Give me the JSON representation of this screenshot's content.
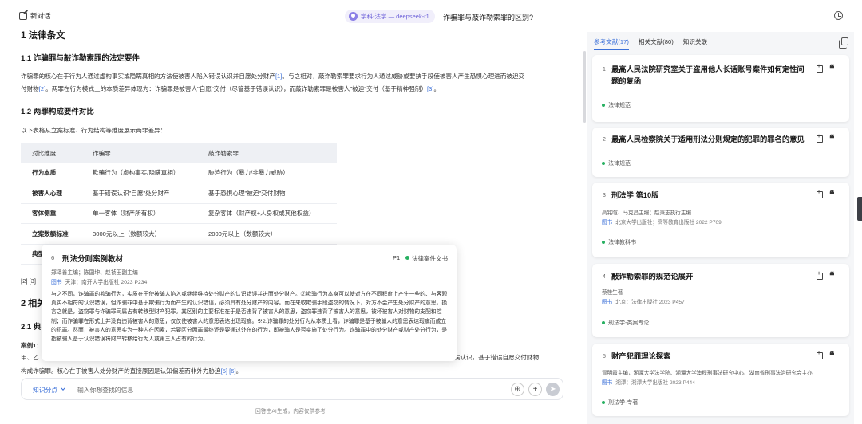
{
  "topbar": {
    "new_chat": "新对话",
    "mode": "学科-法学 — deepseek-r1",
    "chat_title": "诈骗罪与敲诈勒索罪的区别?"
  },
  "article": {
    "h1": "1 法律条文",
    "s1_title": "1.1 诈骗罪与敲诈勒索罪的法定要件",
    "s1_line1": "诈骗罪的核心在于行为人通过虚构事实或隐瞒真相的方法使被害人陷入错误认识并自愿处分财产[1]。与之相对，敲诈勒索罪要求行为人通过威胁或要挟手段使被害人产生恐惧心理进而被迫交",
    "s1_line2": "付财物[2]。两罪在行为模式上的本质差异体现为：诈骗罪是被害人\"自愿\"交付（尽管基于错误认识），而敲诈勒索罪是被害人\"被迫\"交付（基于精神强制）[3]。",
    "s2_title": "1.2 两罪构成要件对比",
    "intro": "以下表格从立案标准、行为结构等维度展示两罪差异：",
    "table": {
      "headers": [
        "对比维度",
        "诈骗罪",
        "敲诈勒索罪"
      ],
      "rows": [
        [
          "行为本质",
          "欺骗行为（虚构事实/隐瞒真相）",
          "胁迫行为（暴力/非暴力威胁）"
        ],
        [
          "被害人心理",
          "基于错误认识\"自愿\"处分财产",
          "基于恐惧心理\"被迫\"交付财物"
        ],
        [
          "客体侧重",
          "单一客体（财产所有权）",
          "复杂客体（财产权+人身权或其他权益）"
        ],
        [
          "立案数额标准",
          "3000元以上（数额较大）",
          "2000元以上（数额较大）"
        ],
        [
          "典型",
          "",
          ""
        ]
      ]
    },
    "refs_line": "[2] [3]",
    "h2_partial": "2 相关",
    "s21_partial": "2.1 典",
    "case_label": "案例1：",
    "case_tail": "陷入错误认识，基于错误自愿交付财物",
    "case_line2_pre": "甲、乙",
    "case_line3": "构成诈骗罪。核心在于被害人处分财产的直接原因是认知偏差而非外力胁迫[5] [6]。"
  },
  "popup": {
    "num": "6",
    "title": "刑法分则案例教材",
    "page": "P1",
    "tag": "法律案件文书",
    "authors": "郑泽善主编；陈国坤、赵祯王副主编",
    "pub_label": "图书",
    "pub": "天津：南开大学出版社 2023 P234",
    "body": "与之不同，诈骗罪的欺骗行为，实质在于使被骗人陷入或继续维持处分财产的认识错误并进而处分财产。②欺骗行为本身可以使对方在不同程度上产生一些的、与客观真实不相符的认识错误，但诈骗罪中基于欺骗行为而产生的认识错误，必须具有处分财产的内容。而在来取欺骗手段盗窃的情况下，对方不会产生处分财产的意思。换言之就是，盗窃罪与诈骗罪同属占有转移型财产犯罪。其区别的主要标准在于是否违背了被害人的意思，盗窃罪违背了被害人的意思，被坏被害人对财物的支配和控制；而诈骗罪在形式上并没有违背被害人的意思，仅仅使被害人的意思表达出现瑕疵。※2.诈骗罪的处分行为从本质上看，诈骗罪是基于被骗人的意思表达瑕疵而成立的犯罪。然而，被害人的意思实为一种内在因素，若要区分两罪最终还是要通过外在的行为，即被骗人是否实施了处分行为。诈骗罪中的处分财产或财产处分行为，是指被骗人基于认识错误将财产转移给行为人或第三人占有的行为。"
  },
  "input": {
    "knowledge": "知识分点",
    "placeholder": "输入你想查找的信息",
    "disclaimer": "回答由AI生成，内容仅供参考"
  },
  "panel": {
    "tabs": [
      "参考文献(17)",
      "相关文献(80)",
      "知识关联"
    ],
    "cards": [
      {
        "num": "1",
        "title": "最高人民法院研究室关于盗用他人长话账号案件如何定性问题的复函",
        "tag": "法律规范"
      },
      {
        "num": "2",
        "title": "最高人民检察院关于适用刑法分则规定的犯罪的罪名的意见",
        "tag": "法律规范"
      },
      {
        "num": "3",
        "title": "刑法学 第10版",
        "meta": "高铭暄、马克昌主编；赵秉志执行主编",
        "pub_label": "图书",
        "pub": "北京大学出版社；高等教育出版社 2022 P709",
        "tag": "法律教科书"
      },
      {
        "num": "4",
        "title": "敲诈勒索罪的规范论展开",
        "meta": "蔡桂生著",
        "pub_label": "图书",
        "pub": "北京：法律出版社 2023 P457",
        "tag": "刑法学-类案专论"
      },
      {
        "num": "5",
        "title": "财产犯罪理论探索",
        "meta": "冒明霞主编，湘潭大学法学院、湘潭大学澳程刑事法研究中心、湖南省刑事法治研究会主办",
        "pub_label": "图书",
        "pub": "湘潭：湘潭大学出版社 2023 P444",
        "tag": "刑法学-专著"
      }
    ]
  }
}
